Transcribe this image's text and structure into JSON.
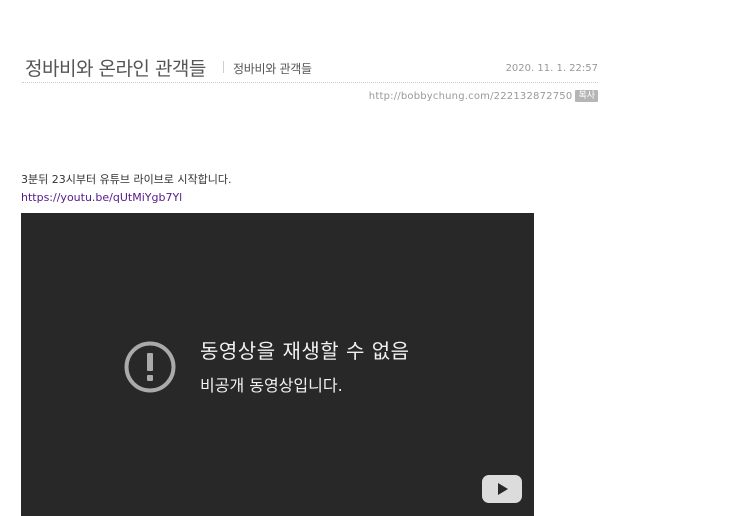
{
  "post": {
    "title": "정바비와 온라인 관객들",
    "category": "정바비와 관객들",
    "date": "2020. 11. 1. 22:57",
    "url": "http://bobbychung.com/222132872750",
    "copy_label": "복사"
  },
  "content": {
    "line1": "3분뒤 23시부터 유튜브 라이브로 시작합니다.",
    "link": "https://youtu.be/qUtMiYgb7Yl"
  },
  "video": {
    "error_title": "동영상을 재생할 수 없음",
    "error_subtitle": "비공개 동영상입니다.",
    "background_color": "#282828"
  },
  "icons": {
    "error": "exclamation-circle-icon",
    "logo": "youtube-logo-icon"
  }
}
